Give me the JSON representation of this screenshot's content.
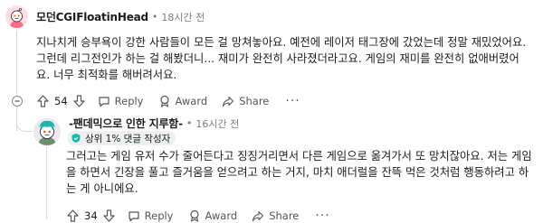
{
  "comments": [
    {
      "username": "모던CGIFloatinHead",
      "time": "18시간 전",
      "body": "지나치게 승부욕이 강한 사람들이 모든 걸 망쳐놓아요. 예전에 레이저 태그장에 갔었는데 정말 재밌었어요. 그런데 리그전인가 하는 걸 해봤더니... 재미가 완전히 사라졌더라고요. 게임의 재미를 완전히 없애버렸어요. 너무 최적화를 해버려서요.",
      "votes": "54",
      "reply_label": "Reply",
      "award_label": "Award",
      "share_label": "Share",
      "more_label": "···",
      "accent": "#ff6a84"
    },
    {
      "username": "-팬데믹으로 인한 지루함-",
      "time": "16시간 전",
      "flair": "상위 1% 댓글 작성자",
      "body": "그러고는 게임 유저 수가 줄어든다고 징징거리면서 다른 게임으로 옮겨가서 또 망치잖아요. 저는 게임을 하면서 긴장을 풀고 즐거움을 얻으려고 하는 거지, 마치 애더럴을 잔뜩 먹은 것처럼 행동하려고 하는 게 아니에요.",
      "votes": "34",
      "reply_label": "Reply",
      "award_label": "Award",
      "share_label": "Share",
      "more_label": "···",
      "accent": "#1fb5a8"
    }
  ],
  "colors": {
    "thread_line": "#d7dadc",
    "muted_text": "#7c7c7c",
    "flair_bg": "#edeff1"
  }
}
